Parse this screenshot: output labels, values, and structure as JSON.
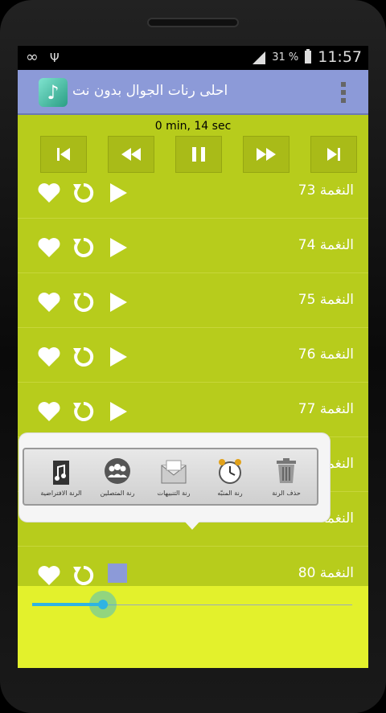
{
  "status": {
    "left_icons": [
      "infinity-icon",
      "usb-icon"
    ],
    "battery": "31 %",
    "time": "11:57"
  },
  "app": {
    "title": "احلى رنات الجوال بدون نت",
    "icon": "music-note-icon",
    "menu_icon": "overflow-menu-icon"
  },
  "player": {
    "time": "0 min, 14 sec",
    "controls": [
      "skip-previous-icon",
      "rewind-icon",
      "pause-icon",
      "fast-forward-icon",
      "skip-next-icon"
    ],
    "progress": 0.22
  },
  "ringtones": [
    {
      "label": "النغمة 73",
      "state": "play"
    },
    {
      "label": "النغمة 74",
      "state": "play"
    },
    {
      "label": "النغمة 75",
      "state": "play"
    },
    {
      "label": "النغمة 76",
      "state": "play"
    },
    {
      "label": "النغمة 77",
      "state": "play"
    },
    {
      "label": "النغمة",
      "state": "hidden"
    },
    {
      "label": "النغمة",
      "state": "hidden"
    },
    {
      "label": "النغمة 80",
      "state": "stop"
    }
  ],
  "popup_menu": {
    "items": [
      {
        "label": "الرنة الافتراضية",
        "icon": "music-file-icon"
      },
      {
        "label": "رنة المتصلين",
        "icon": "contacts-icon"
      },
      {
        "label": "رنة التنبيهات",
        "icon": "envelope-icon"
      },
      {
        "label": "رنة المنبّه",
        "icon": "alarm-clock-icon"
      },
      {
        "label": "حذف الرنة",
        "icon": "trash-icon"
      }
    ]
  },
  "colors": {
    "accent": "#8c9ad8",
    "list_bg": "#b7cc1c",
    "bottom_bg": "#e3f12c",
    "seek": "#2fb3e3"
  }
}
